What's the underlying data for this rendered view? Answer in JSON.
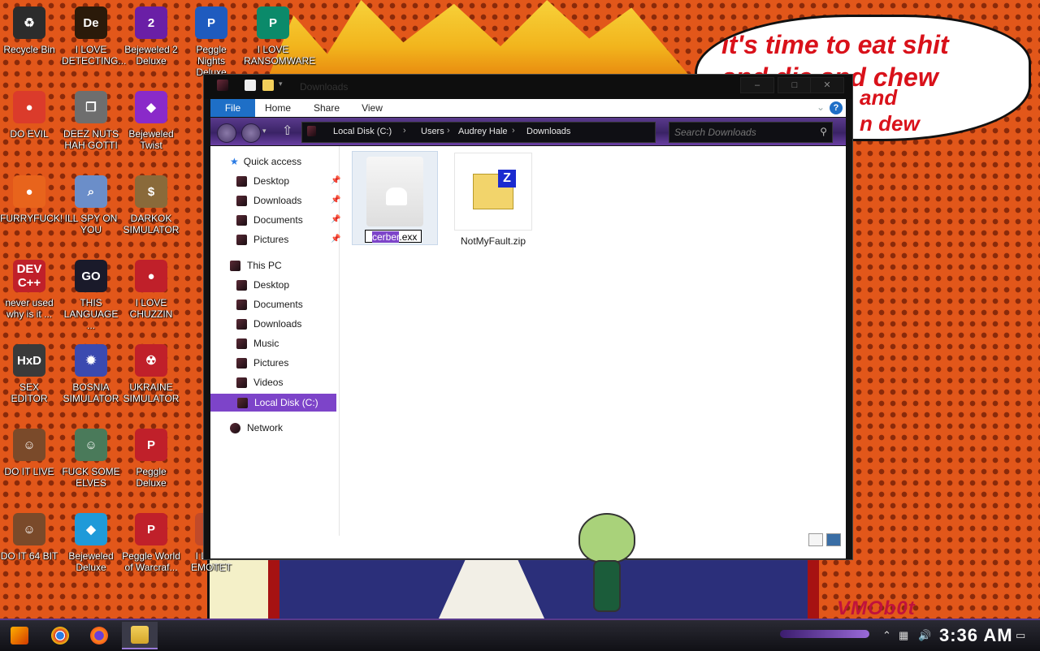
{
  "desktop": {
    "speech_bubble": [
      "it's time to eat shit",
      "and die and chew",
      "and",
      "n dew"
    ],
    "watermark": "VMOb0t",
    "icons": [
      {
        "label": "Recycle Bin",
        "glyph": "♻",
        "color": "#2c2c2c"
      },
      {
        "label": "I LOVE DETECTING...",
        "glyph": "De",
        "color": "#2b1a0a"
      },
      {
        "label": "Bejeweled 2 Deluxe",
        "glyph": "2",
        "color": "#6a1fa6"
      },
      {
        "label": "Peggle Nights Deluxe",
        "glyph": "P",
        "color": "#1f5bbf"
      },
      {
        "label": "I LOVE RANSOMWARE",
        "glyph": "P",
        "color": "#0b8a6a"
      },
      {
        "label": "DO EVIL",
        "glyph": "●",
        "color": "#db3b2b"
      },
      {
        "label": "DEEZ NUTS HAH GOTTI",
        "glyph": "❐",
        "color": "#6e6e6e"
      },
      {
        "label": "Bejeweled Twist",
        "glyph": "◆",
        "color": "#8a2ac9"
      },
      {
        "label": "FURRYFUCK!",
        "glyph": "●",
        "color": "#e8641c"
      },
      {
        "label": "ILL SPY ON YOU",
        "glyph": "⌕",
        "color": "#6b8ec9"
      },
      {
        "label": "DARKOK SIMULATOR",
        "glyph": "$",
        "color": "#8a6a3a"
      },
      {
        "label": "never used why is it ...",
        "glyph": "DEV C++",
        "color": "#c0202a"
      },
      {
        "label": "THIS LANGUAGE ...",
        "glyph": "GO",
        "color": "#1a1a2a"
      },
      {
        "label": "I LOVE CHUZZIN",
        "glyph": "●",
        "color": "#c0202a"
      },
      {
        "label": "SEX EDITOR",
        "glyph": "HxD",
        "color": "#3a3a3a"
      },
      {
        "label": "BOSNIA SIMULATOR",
        "glyph": "✹",
        "color": "#3b4ab0"
      },
      {
        "label": "UKRAINE SIMULATOR",
        "glyph": "☢",
        "color": "#c0202a"
      },
      {
        "label": "DO IT LIVE",
        "glyph": "☺",
        "color": "#7a4a2a"
      },
      {
        "label": "FUCK SOME ELVES",
        "glyph": "☺",
        "color": "#4a7a5a"
      },
      {
        "label": "Peggle Deluxe",
        "glyph": "P",
        "color": "#c0202a"
      },
      {
        "label": "DO IT 64 BIT",
        "glyph": "☺",
        "color": "#7a4a2a"
      },
      {
        "label": "Bejeweled Deluxe",
        "glyph": "◆",
        "color": "#1f9ad9"
      },
      {
        "label": "Peggle World of Warcraf...",
        "glyph": "P",
        "color": "#c0202a"
      },
      {
        "label": "I LOVE EMOTET",
        "glyph": "■",
        "color": "#c04a2a"
      }
    ]
  },
  "window": {
    "title": "Downloads",
    "ribbon_tabs": [
      "File",
      "Home",
      "Share",
      "View"
    ],
    "help": "?",
    "breadcrumb": [
      "Local Disk (C:)",
      "Users",
      "Audrey Hale",
      "Downloads"
    ],
    "search_placeholder": "Search Downloads",
    "nav": {
      "quick_access": "Quick access",
      "quick_items": [
        "Desktop",
        "Downloads",
        "Documents",
        "Pictures"
      ],
      "this_pc": "This PC",
      "pc_items": [
        "Desktop",
        "Documents",
        "Downloads",
        "Music",
        "Pictures",
        "Videos"
      ],
      "selected": "Local Disk (C:)",
      "network": "Network"
    },
    "files": [
      {
        "rename_selected": "cerber",
        "rename_rest": ".exx"
      },
      {
        "name": "NotMyFault.zip"
      }
    ]
  },
  "taskbar": {
    "clock": "3:36 AM",
    "accent": "#7d44c9"
  }
}
